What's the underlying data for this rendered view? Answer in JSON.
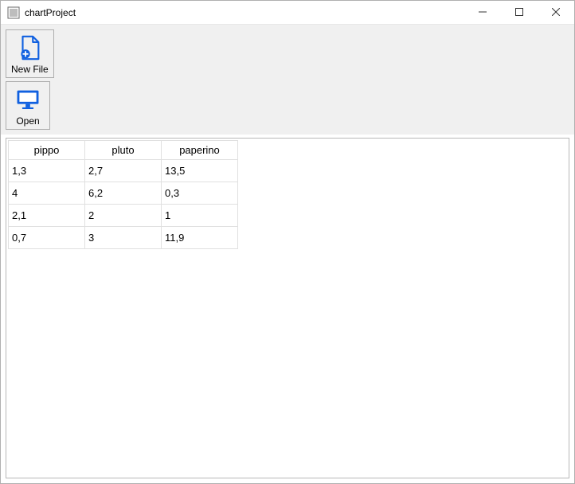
{
  "window": {
    "title": "chartProject"
  },
  "toolbar": {
    "new_file_label": "New File",
    "open_label": "Open"
  },
  "table": {
    "headers": [
      "pippo",
      "pluto",
      "paperino"
    ],
    "rows": [
      [
        "1,3",
        "2,7",
        "13,5"
      ],
      [
        "4",
        "6,2",
        "0,3"
      ],
      [
        "2,1",
        "2",
        "1"
      ],
      [
        "0,7",
        "3",
        "11,9"
      ]
    ]
  },
  "chart_data": {
    "type": "table",
    "columns": [
      "pippo",
      "pluto",
      "paperino"
    ],
    "rows": [
      [
        1.3,
        2.7,
        13.5
      ],
      [
        4,
        6.2,
        0.3
      ],
      [
        2.1,
        2,
        1
      ],
      [
        0.7,
        3,
        11.9
      ]
    ]
  }
}
